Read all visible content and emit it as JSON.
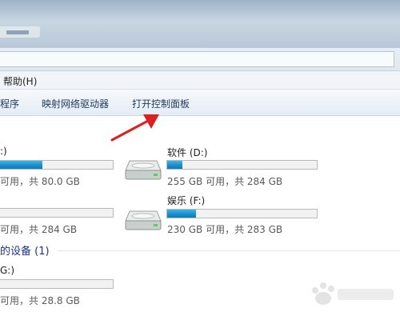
{
  "menubar": {
    "help": "帮助(H)"
  },
  "toolbar": {
    "items": [
      {
        "label": "程序"
      },
      {
        "label": "映射网络驱动器"
      },
      {
        "label": "打开控制面板"
      }
    ]
  },
  "drives": [
    {
      "label": ":)",
      "free": "可用，共 80.0 GB",
      "used_fraction": 0.38
    },
    {
      "label": "软件 (D:)",
      "free": "255 GB 可用，共 284 GB",
      "used_fraction": 0.1
    },
    {
      "label": "",
      "free": "可用，共 284 GB",
      "used_fraction": 0.0
    },
    {
      "label": "娱乐 (F:)",
      "free": "230 GB 可用，共 283 GB",
      "used_fraction": 0.19
    }
  ],
  "removable": {
    "header": "的设备 (1)",
    "drive": {
      "label": "G:)",
      "free": "可用，共 28.8 GB",
      "used_fraction": 0.0
    }
  },
  "colors": {
    "bar_fill": "#1a8fcf",
    "group_header": "#1e3287",
    "arrow": "#e02020"
  }
}
